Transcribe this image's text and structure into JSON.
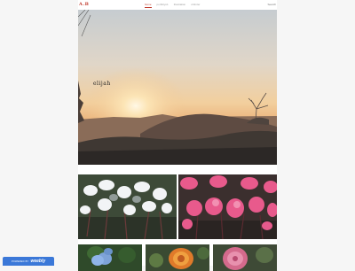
{
  "site": {
    "logo": "A.B"
  },
  "nav": {
    "items": [
      {
        "label": "home"
      },
      {
        "label": "portfolyo1"
      },
      {
        "label": "illustration"
      },
      {
        "label": "cizimler"
      }
    ],
    "search_label": "Search"
  },
  "hero": {
    "title": "elijah"
  },
  "badge": {
    "prefix": "POWERED BY",
    "brand": "weebly"
  },
  "colors": {
    "accent": "#c0392b",
    "badge": "#3b78d8"
  }
}
